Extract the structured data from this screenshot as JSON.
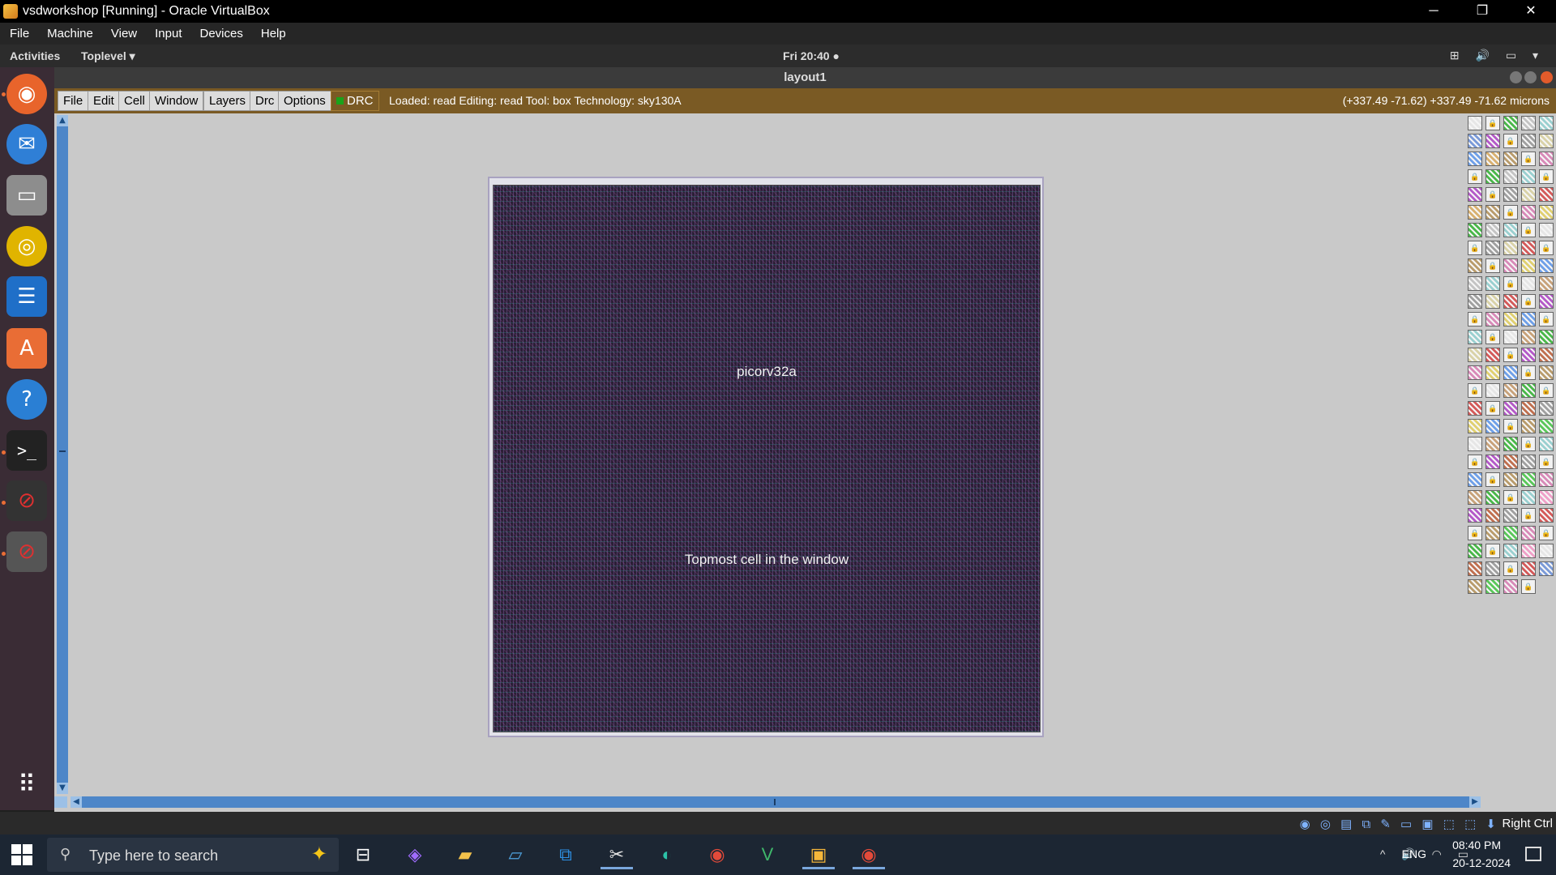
{
  "host_window": {
    "title": "vsdworkshop [Running] - Oracle VirtualBox",
    "minimize": "─",
    "restore": "❐",
    "close": "✕",
    "menu": [
      "File",
      "Machine",
      "View",
      "Input",
      "Devices",
      "Help"
    ]
  },
  "gnome": {
    "activities": "Activities",
    "toplevel": "Toplevel ▾",
    "clock": "Fri 20:40 ●",
    "tray": "⊞ 🔊 ▭ ▾"
  },
  "dock": {
    "items": [
      "firefox-icon",
      "thunderbird-icon",
      "files-icon",
      "rhythmbox-icon",
      "writer-icon",
      "app-store-icon",
      "help-icon",
      "terminal-icon",
      "blocked-app-icon",
      "blocked-app-icon",
      "app-grid-icon"
    ]
  },
  "magic": {
    "window_title": "layout1",
    "menu": [
      "File",
      "Edit",
      "Cell",
      "Window",
      "Layers",
      "Drc",
      "Options"
    ],
    "drc_label": "DRC",
    "status": "Loaded: read Editing: read Tool: box  Technology: sky130A",
    "coords": "(+337.49 -71.62) +337.49 -71.62 microns",
    "cell_name": "picorv32a",
    "cell_caption": "Topmost cell in the window"
  },
  "vb_status": {
    "host_key": "Right Ctrl",
    "icons": "◉ ◎ ▤ ⧉ ✎ ▭ ▣ ⬚ ⬚ ⬇"
  },
  "taskbar": {
    "search_placeholder": "Type here to search",
    "time": "08:40 PM",
    "date": "20-12-2024",
    "lang": "ENG",
    "tray": "^ 🔊 ◠ ▭"
  },
  "colors": {
    "magic_toolbar": "#7a5a24",
    "layout_bg": "#c9c9c9",
    "chip_fill": "#2a1f35",
    "scrollbar": "#4d86c8"
  }
}
